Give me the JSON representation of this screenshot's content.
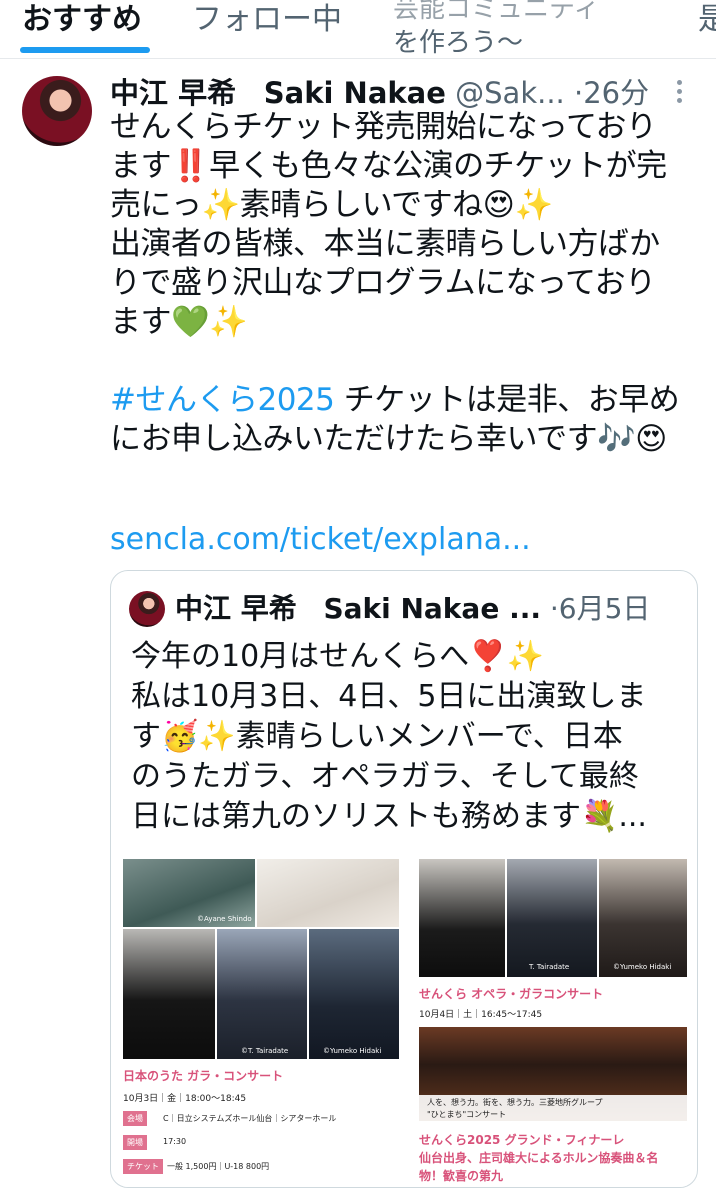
{
  "tabs": {
    "active": "おすすめ",
    "following": "フォロー中",
    "tab3_line1": "芸能コミュニティ",
    "tab3_line2": "を作ろう〜",
    "tab4_partial": "是"
  },
  "post": {
    "display_name": "中江 早希",
    "name_en": "Saki Nakae",
    "handle": "@Sak...",
    "time": "·26分",
    "lines": [
      "せんくらチケット発売開始になっており",
      "ます‼️早くも色々な公演のチケットが完",
      "売にっ✨素晴らしいですね😍✨",
      "出演者の皆様、本当に素晴らしい方ばか",
      "りで盛り沢山なプログラムになっており",
      "ます💚✨"
    ],
    "hashtag": "#せんくら2025",
    "hashtag_rest": " チケットは是非、お早め",
    "line_last": "にお申し込みいただけたら幸いです🎶😍",
    "link": "sencla.com/ticket/explana..."
  },
  "quote": {
    "display_name": "中江 早希",
    "name_en": "Saki Nakae ...",
    "time": "·6月5日",
    "lines": [
      "今年の10月はせんくらへ❣️✨",
      "私は10月3日、4日、5日に出演致しま",
      "す🥳✨素晴らしいメンバーで、日本",
      "のうたガラ、オペラガラ、そして最終",
      "日には第九のソリストも務めます💐..."
    ]
  },
  "poster_left": {
    "credit_top": "©Ayane Shindo",
    "credit1": "©T. Tairadate",
    "credit2": "©Yumeko Hidaki",
    "title": "日本のうた ガラ・コンサート",
    "date": "10月3日｜金｜18:00～18:45",
    "venue_label": "会場",
    "venue": "C｜日立システムズホール仙台｜シアターホール",
    "open_label": "開場",
    "open": "17:30",
    "ticket_label": "チケット",
    "ticket": "一般 1,500円｜U-18 800円"
  },
  "poster_right": {
    "credit1": "T. Tairadate",
    "credit2": "©Yumeko Hidaki",
    "title": "せんくら オペラ・ガラコンサート",
    "date": "10月4日｜土｜16:45～17:45",
    "banner_line1": "人を、想う力。街を、想う力。三菱地所グループ",
    "banner_line2": "\"ひとまち\"コンサート",
    "finale_title": "せんくら2025 グランド・フィナーレ",
    "finale_line2": "仙台出身、庄司雄大によるホルン協奏曲＆名",
    "finale_line3": "物！歓喜の第九"
  }
}
